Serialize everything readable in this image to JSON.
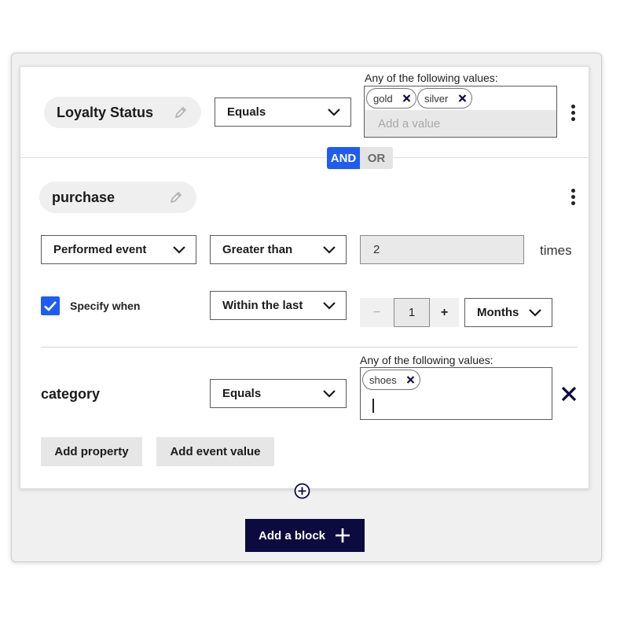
{
  "block1": {
    "property_name": "Loyalty Status",
    "operator": "Equals",
    "values_label": "Any of the following values:",
    "tags": [
      "gold",
      "silver"
    ],
    "add_value_placeholder": "Add a value"
  },
  "logic": {
    "and_label": "AND",
    "or_label": "OR"
  },
  "block2": {
    "event_name": "purchase",
    "event_condition": "Performed event",
    "comparison": "Greater than",
    "count_value": "2",
    "count_unit": "times",
    "specify_when_label": "Specify when",
    "specify_when_checked": true,
    "time_relation": "Within the last",
    "stepper_minus": "−",
    "stepper_value": "1",
    "stepper_plus": "+",
    "time_unit": "Months",
    "sub_property": {
      "name": "category",
      "operator": "Equals",
      "values_label": "Any of the following values:",
      "tags": [
        "shoes"
      ]
    },
    "add_property_label": "Add property",
    "add_event_value_label": "Add event value"
  },
  "footer": {
    "add_block_label": "Add a block"
  },
  "colors": {
    "accent": "#1f5cf0",
    "navy": "#0c0a3e",
    "checkbox": "#1f5cf0"
  },
  "icons": [
    "pencil-icon",
    "chevron-down-icon",
    "close-icon",
    "kebab-menu-icon",
    "plus-circle-icon",
    "plus-icon",
    "checkmark-icon"
  ]
}
